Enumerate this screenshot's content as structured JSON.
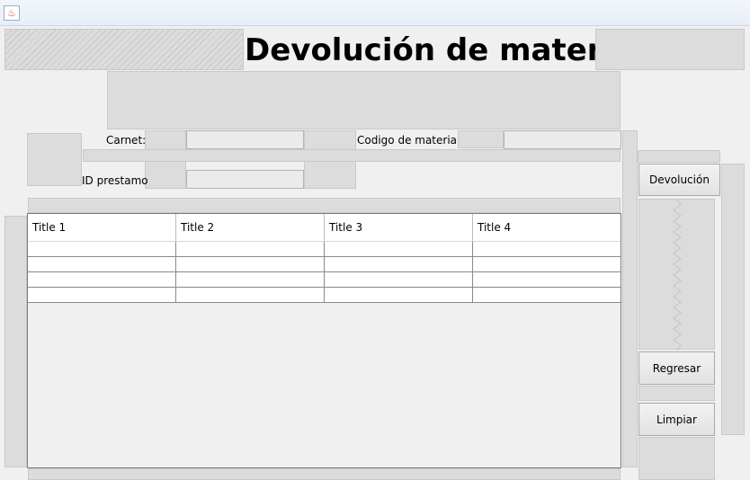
{
  "window": {
    "icon": "java-cup-icon"
  },
  "title": "Devolución de material",
  "form": {
    "carnet_label": "Carnet:",
    "carnet_value": "",
    "codigo_label": "Codigo de material:",
    "codigo_value": "",
    "id_prestamo_label": "ID prestamo",
    "id_prestamo_value": ""
  },
  "buttons": {
    "devolucion": "Devolución",
    "regresar": "Regresar",
    "limpiar": "Limpiar"
  },
  "table": {
    "columns": [
      "Title 1",
      "Title 2",
      "Title 3",
      "Title 4"
    ],
    "rows": [
      [
        "",
        "",
        "",
        ""
      ],
      [
        "",
        "",
        "",
        ""
      ],
      [
        "",
        "",
        "",
        ""
      ],
      [
        "",
        "",
        "",
        ""
      ]
    ]
  }
}
